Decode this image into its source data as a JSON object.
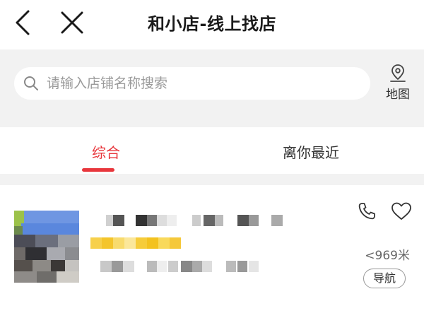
{
  "header": {
    "title": "和小店-线上找店",
    "back_icon": "chevron-left-icon",
    "close_icon": "close-icon"
  },
  "search": {
    "placeholder": "请输入店铺名称搜索",
    "value": "",
    "icon": "search-icon"
  },
  "map_button": {
    "label": "地图",
    "icon": "location-pin-icon"
  },
  "tabs": [
    {
      "label": "综合",
      "active": true
    },
    {
      "label": "离你最近",
      "active": false
    }
  ],
  "colors": {
    "accent": "#e8363c",
    "page_background": "#f2f2f2"
  },
  "stores": [
    {
      "name": "",
      "address": "",
      "distance": "<969米",
      "navigate_label": "导航",
      "phone_icon": "phone-icon",
      "favorite_icon": "heart-icon"
    }
  ]
}
